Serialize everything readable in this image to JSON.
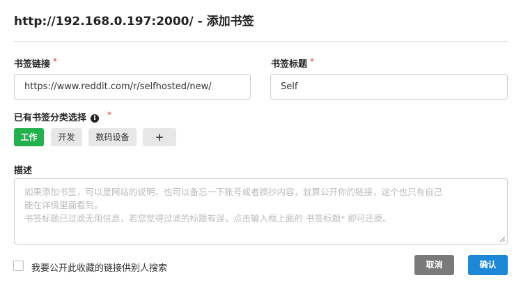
{
  "dialog": {
    "title": "http://192.168.0.197:2000/ - 添加书签"
  },
  "form": {
    "link": {
      "label": "书签链接",
      "required_mark": "*",
      "value": "https://www.reddit.com/r/selfhosted/new/"
    },
    "bookmark_title": {
      "label": "书签标题",
      "required_mark": "*",
      "value": "Self"
    },
    "category": {
      "label": "已有书签分类选择",
      "info_icon": "info-icon",
      "required_mark": "*",
      "tags": [
        {
          "label": "工作",
          "active": true
        },
        {
          "label": "开发",
          "active": false
        },
        {
          "label": "数码设备",
          "active": false
        }
      ],
      "add_label": "+"
    },
    "description": {
      "label": "描述",
      "placeholder_lines": [
        "如果添加书签，可以是网站的说明，也可以备忘一下账号或者摘抄内容，就算公开你的链接，这个也只有自己",
        "能在详情里面看到。",
        "书签标题已过滤无用信息，若您觉得过滤的标题有误，点击输入框上面的 书签标题* 即可还原。"
      ]
    },
    "public_checkbox": {
      "label": "我要公开此收藏的链接供别人搜索",
      "checked": false
    }
  },
  "buttons": {
    "cancel": "取消",
    "confirm": "确认"
  },
  "colors": {
    "active_tag": "#22b14c",
    "primary": "#1e88d8",
    "cancel": "#7a7a7a",
    "required": "#e53935"
  }
}
